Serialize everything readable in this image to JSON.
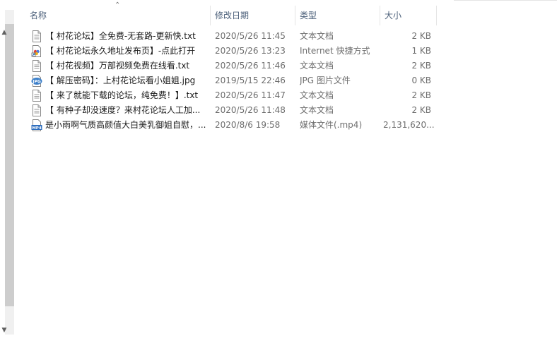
{
  "columns": {
    "name": "名称",
    "date": "修改日期",
    "type": "类型",
    "size": "大小"
  },
  "files": [
    {
      "icon": "text-file-icon",
      "name": "【 村花论坛】全免费-无套路-更新快.txt",
      "date": "2020/5/26 11:45",
      "type": "文本文档",
      "size": "2 KB"
    },
    {
      "icon": "internet-shortcut-icon",
      "name": "【 村花论坛永久地址发布页】-点此打开",
      "date": "2020/5/26 13:23",
      "type": "Internet 快捷方式",
      "size": "1 KB"
    },
    {
      "icon": "text-file-icon",
      "name": "【 村花视频】万部视频免费在线看.txt",
      "date": "2020/5/26 11:46",
      "type": "文本文档",
      "size": "2 KB"
    },
    {
      "icon": "jpg-file-icon",
      "name": "【 解压密码】：上村花论坛看小姐姐.jpg",
      "date": "2019/5/15 22:46",
      "type": "JPG 图片文件",
      "size": "0 KB"
    },
    {
      "icon": "text-file-icon",
      "name": "【 来了就能下载的论坛，纯免费！】.txt",
      "date": "2020/5/26 11:47",
      "type": "文本文档",
      "size": "2 KB"
    },
    {
      "icon": "text-file-icon",
      "name": "【 有种子却没速度？来村花论坛人工加...",
      "date": "2020/5/26 11:48",
      "type": "文本文档",
      "size": "2 KB"
    },
    {
      "icon": "mp4-file-icon",
      "name": "是小雨啊气质高颜值大白美乳御姐自慰，...",
      "date": "2020/8/6 19:58",
      "type": "媒体文件(.mp4)",
      "size": "2,131,620..."
    }
  ]
}
